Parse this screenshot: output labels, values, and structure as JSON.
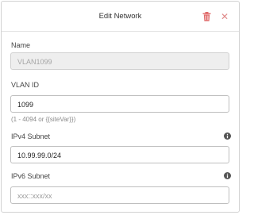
{
  "dialog": {
    "title": "Edit Network"
  },
  "fields": {
    "name": {
      "label": "Name",
      "value": "VLAN1099"
    },
    "vlan_id": {
      "label": "VLAN ID",
      "value": "1099",
      "hint": "(1 - 4094 or {{siteVar}})"
    },
    "ipv4": {
      "label": "IPv4 Subnet",
      "value": "10.99.99.0/24"
    },
    "ipv6": {
      "label": "IPv6 Subnet",
      "placeholder": "xxx::xxx/xx"
    }
  },
  "icons": {
    "delete": "trash-icon",
    "close": "close-icon",
    "info": "info-icon"
  },
  "colors": {
    "delete_icon": "#e06b6b",
    "close_icon": "#e08a8a",
    "disabled_bg": "#eeeeee"
  }
}
